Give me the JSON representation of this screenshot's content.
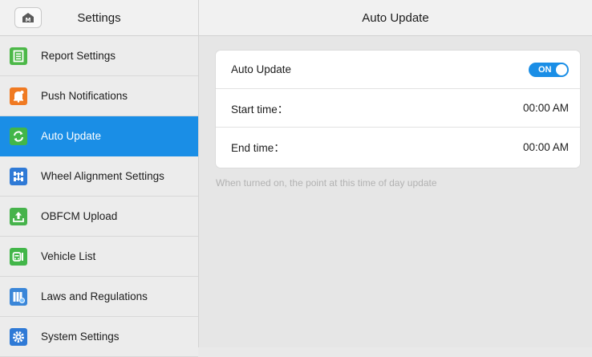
{
  "sidebar": {
    "title": "Settings",
    "home_icon": "home-m-icon",
    "items": [
      {
        "label": "Report Settings",
        "icon": "report-icon",
        "color": "#4cb848",
        "active": false
      },
      {
        "label": "Push Notifications",
        "icon": "bell-icon",
        "color": "#f07a22",
        "active": false
      },
      {
        "label": "Auto Update",
        "icon": "refresh-icon",
        "color": "#42b649",
        "active": true
      },
      {
        "label": "Wheel Alignment Settings",
        "icon": "alignment-icon",
        "color": "#2f7ad6",
        "active": false
      },
      {
        "label": "OBFCM Upload",
        "icon": "upload-icon",
        "color": "#46b34b",
        "active": false
      },
      {
        "label": "Vehicle List",
        "icon": "vehicle-list-icon",
        "color": "#42b649",
        "active": false
      },
      {
        "label": "Laws and Regulations",
        "icon": "law-book-icon",
        "color": "#3a86d8",
        "active": false
      },
      {
        "label": "System Settings",
        "icon": "gear-icon",
        "color": "#2f7ad6",
        "active": false
      }
    ]
  },
  "main": {
    "title": "Auto Update",
    "auto_update": {
      "label": "Auto Update",
      "toggle_text": "ON",
      "on": true
    },
    "start_time": {
      "label": "Start time：",
      "value": "00:00 AM"
    },
    "end_time": {
      "label": "End time：",
      "value": "00:00 AM"
    },
    "hint": "When turned on, the point at this time of day update"
  },
  "colors": {
    "accent": "#1a8ee6"
  }
}
